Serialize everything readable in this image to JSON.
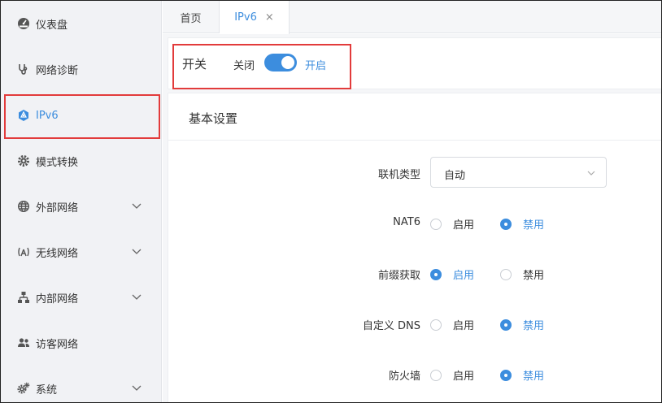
{
  "sidebar": {
    "items": [
      {
        "label": "仪表盘",
        "icon": "dashboard-icon"
      },
      {
        "label": "网络诊断",
        "icon": "stethoscope-icon"
      },
      {
        "label": "IPv6",
        "icon": "ipv6-network-icon"
      },
      {
        "label": "模式转换",
        "icon": "gear-icon"
      },
      {
        "label": "外部网络",
        "icon": "globe-icon"
      },
      {
        "label": "无线网络",
        "icon": "wifi-antenna-icon"
      },
      {
        "label": "内部网络",
        "icon": "lan-icon"
      },
      {
        "label": "访客网络",
        "icon": "users-icon"
      },
      {
        "label": "系统",
        "icon": "gears-icon"
      }
    ]
  },
  "tabs": {
    "home": "首页",
    "ipv6": "IPv6",
    "close": "×"
  },
  "switch_panel": {
    "title": "开关",
    "off_label": "关闭",
    "on_label": "开启",
    "state": "on"
  },
  "basic": {
    "title": "基本设置",
    "connection_type": {
      "label": "联机类型",
      "value": "自动"
    },
    "nat6": {
      "label": "NAT6",
      "enable": "启用",
      "disable": "禁用",
      "selected": "disable"
    },
    "prefix": {
      "label": "前缀获取",
      "enable": "启用",
      "disable": "禁用",
      "selected": "enable"
    },
    "custom_dns": {
      "label": "自定义 DNS",
      "enable": "启用",
      "disable": "禁用",
      "selected": "disable"
    },
    "firewall": {
      "label": "防火墙",
      "enable": "启用",
      "disable": "禁用",
      "selected": "disable"
    }
  },
  "colors": {
    "accent": "#3c8dde",
    "highlight": "#e23b3b",
    "sidebar_bg": "#f1f2f5"
  }
}
